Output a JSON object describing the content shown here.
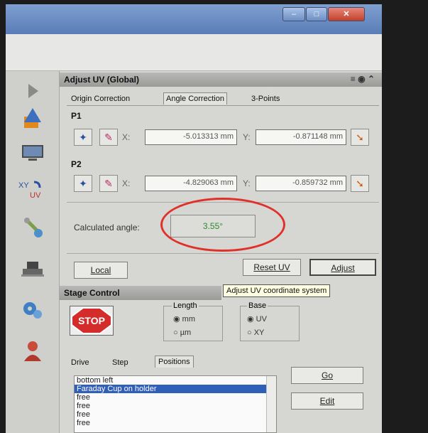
{
  "panel_title": "Adjust UV (Global)",
  "tabs": [
    "Origin Correction",
    "Angle Correction",
    "3-Points"
  ],
  "p1": {
    "label": "P1",
    "x": "-5.013313 mm",
    "y": "-0.871148 mm"
  },
  "p2": {
    "label": "P2",
    "x": "-4.829063 mm",
    "y": "-0.859732 mm"
  },
  "x_label": "X:",
  "y_label": "Y:",
  "calculated_angle": {
    "label": "Calculated angle:",
    "value": "3.55°"
  },
  "buttons": {
    "local": "Local",
    "reset_uv": "Reset UV",
    "adjust": "Adjust"
  },
  "tooltip": "Adjust UV coordinate system",
  "stage": {
    "title": "Stage Control",
    "stop": "STOP",
    "length_label": "Length",
    "length_mm": "mm",
    "length_um": "µm",
    "base_label": "Base",
    "base_uv": "UV",
    "base_xy": "XY",
    "tabs": [
      "Drive",
      "Step",
      "Positions"
    ],
    "go": "Go",
    "edit": "Edit"
  },
  "positions": [
    "bottom left",
    "Faraday Cup on holder",
    "free",
    "free",
    "free",
    "free"
  ],
  "colors": {
    "panel_bg": "#d6d6d3",
    "selection": "#2f5fb8",
    "stop_red": "#d42b2b",
    "angle_green": "#2e8b2e",
    "highlight_circle": "#e0302a"
  },
  "icons": [
    "play-icon",
    "shapes-icon",
    "monitor-icon",
    "xy-uv-icon",
    "tools-icon",
    "stage-icon",
    "gears-icon",
    "user-icon"
  ]
}
